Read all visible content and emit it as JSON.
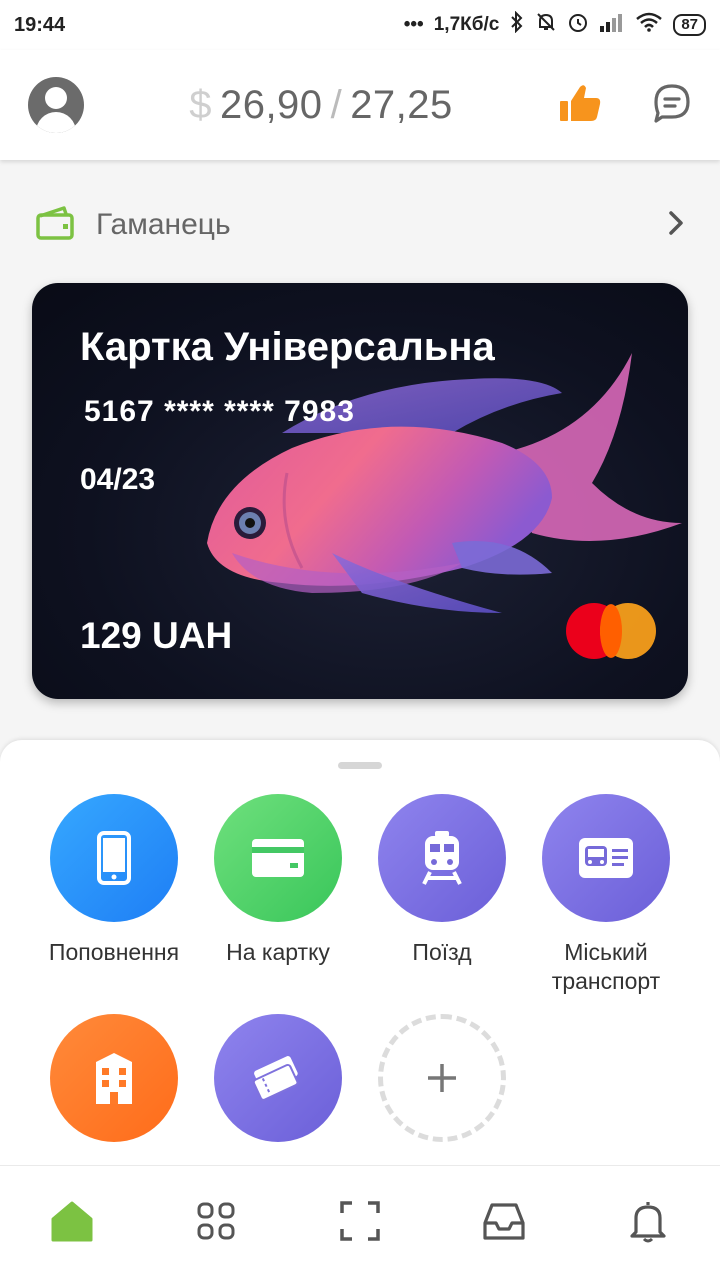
{
  "status_bar": {
    "time": "19:44",
    "network_speed": "1,7Кб/с",
    "battery": "87"
  },
  "header": {
    "currency_symbol": "$",
    "balance_current": "26,90",
    "separator": "/",
    "balance_limit": "27,25",
    "icons": [
      "avatar-icon",
      "thumbs-up-icon",
      "chat-icon"
    ],
    "accent": "#f7941d"
  },
  "wallet": {
    "label": "Гаманець"
  },
  "card": {
    "title": "Картка Універсальна",
    "number": "5167 **** **** 7983",
    "expiry": "04/23",
    "balance": "129 UAH",
    "brand": "mastercard"
  },
  "actions": [
    {
      "label": "Поповнення",
      "icon": "phone-icon",
      "color": "#1e7ef5"
    },
    {
      "label": "На картку",
      "icon": "card-icon",
      "color": "#39c65a"
    },
    {
      "label": "Поїзд",
      "icon": "train-icon",
      "color": "#6b5fd8"
    },
    {
      "label": "Міський транспорт",
      "icon": "bus-icon",
      "color": "#6b5fd8"
    },
    {
      "label": "",
      "icon": "building-icon",
      "color": "#ff6c1a"
    },
    {
      "label": "",
      "icon": "tickets-icon",
      "color": "#6b5fd8"
    },
    {
      "label": "",
      "icon": "plus-icon",
      "color": "#dcdcdc"
    }
  ],
  "bottom_nav": {
    "items": [
      "home-icon",
      "grid-icon",
      "scan-icon",
      "inbox-icon",
      "bell-icon"
    ],
    "active_color": "#7cc242"
  }
}
